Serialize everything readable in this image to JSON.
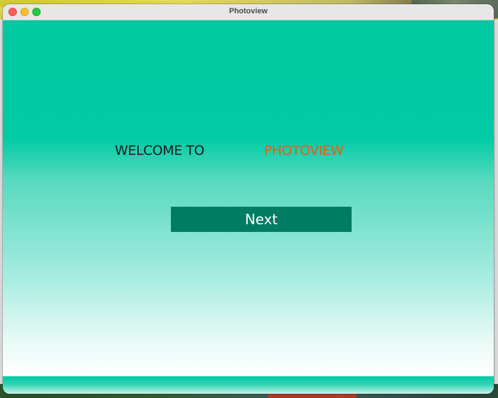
{
  "window": {
    "title": "Photoview"
  },
  "welcome": {
    "prefix": "WELCOME TO",
    "brand": "PHOTOVIEW"
  },
  "actions": {
    "next_label": "Next"
  },
  "colors": {
    "accent_teal": "#00c9a1",
    "brand_orange": "#f05a12",
    "button_green": "#007c63"
  }
}
